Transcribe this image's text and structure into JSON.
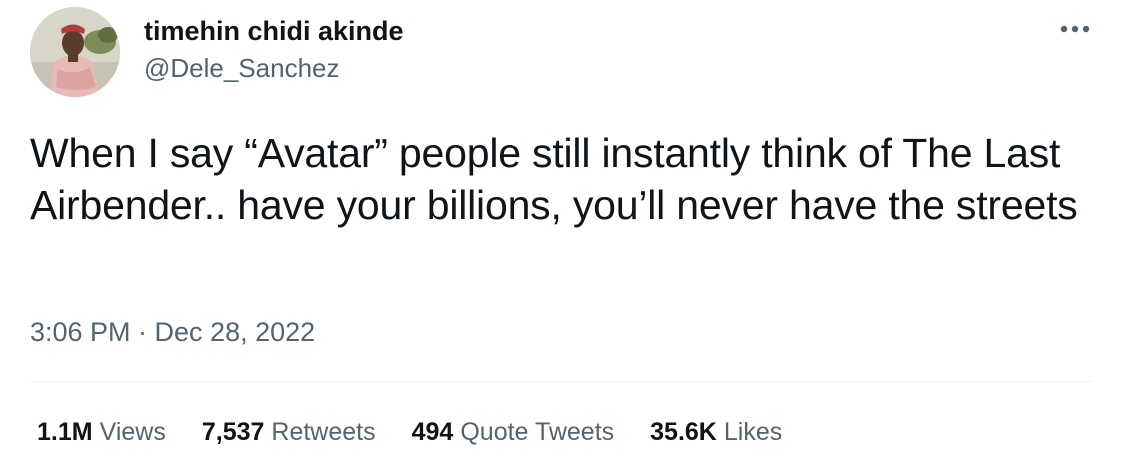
{
  "author": {
    "display_name": "timehin chidi akinde",
    "handle": "@Dele_Sanchez",
    "avatar_icon": "user-photo"
  },
  "more_icon": "more-horizontal-icon",
  "tweet": {
    "text": "When I say “Avatar” people still instantly think of The Last Airbender.. have your billions, you’ll never have the streets",
    "timestamp": "3:06 PM · Dec 28, 2022"
  },
  "stats": {
    "views": {
      "value": "1.1M",
      "label": "Views"
    },
    "retweets": {
      "value": "7,537",
      "label": "Retweets"
    },
    "quote_tweets": {
      "value": "494",
      "label": "Quote Tweets"
    },
    "likes": {
      "value": "35.6K",
      "label": "Likes"
    }
  },
  "colors": {
    "primary_text": "#0f1419",
    "secondary_text": "#536471",
    "divider": "#eff3f4"
  }
}
